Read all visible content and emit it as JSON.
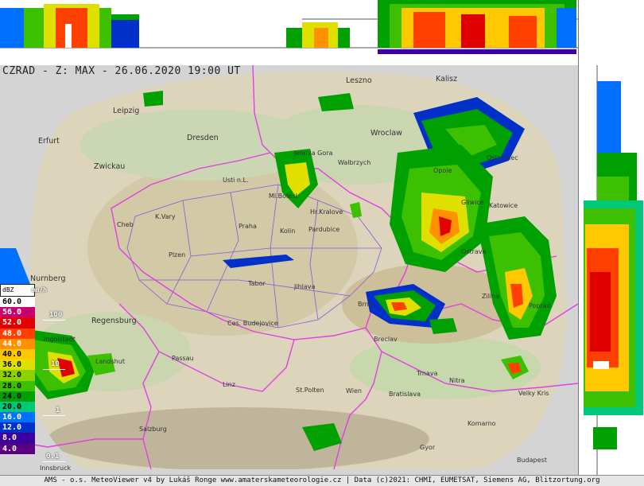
{
  "title": "CZRAD - Z: MAX - 26.06.2020 19:00 UT",
  "footer": "AMS - o.s. MeteoViewer v4 by Lukáš Ronge www.amaterskameteorologie.cz | Data (c)2021: CHMI, EUMETSAT, Siemens AG, Blitzortung.org",
  "legend": {
    "header": "dBZ",
    "unit": "mm/h",
    "rows": [
      {
        "label": "60.0",
        "color": "#ffffff",
        "text": "#000000"
      },
      {
        "label": "56.0",
        "color": "#c8006e",
        "text": "#ffffff"
      },
      {
        "label": "52.0",
        "color": "#e00000",
        "text": "#ffffff"
      },
      {
        "label": "48.0",
        "color": "#ff4000",
        "text": "#ffffff"
      },
      {
        "label": "44.0",
        "color": "#ff9000",
        "text": "#ffffff"
      },
      {
        "label": "40.0",
        "color": "#ffc800",
        "text": "#000000"
      },
      {
        "label": "36.0",
        "color": "#e0e000",
        "text": "#000000"
      },
      {
        "label": "32.0",
        "color": "#8cd200",
        "text": "#000000"
      },
      {
        "label": "28.0",
        "color": "#3cc000",
        "text": "#000000"
      },
      {
        "label": "24.0",
        "color": "#00a000",
        "text": "#000000"
      },
      {
        "label": "20.0",
        "color": "#00c878",
        "text": "#000000"
      },
      {
        "label": "16.0",
        "color": "#0070ff",
        "text": "#ffffff"
      },
      {
        "label": "12.0",
        "color": "#0030c8",
        "text": "#ffffff"
      },
      {
        "label": "8.0",
        "color": "#3c00a0",
        "text": "#ffffff"
      },
      {
        "label": "4.0",
        "color": "#5a0082",
        "text": "#ffffff"
      }
    ],
    "rates": [
      "100",
      "10",
      "1",
      "0.1"
    ]
  },
  "cities": [
    {
      "name": "Leszno"
    },
    {
      "name": "Kalisz"
    },
    {
      "name": "Leipzig"
    },
    {
      "name": "Wroclaw"
    },
    {
      "name": "Erfurt"
    },
    {
      "name": "Dresden"
    },
    {
      "name": "Jelenia Gora"
    },
    {
      "name": "Walbrzych"
    },
    {
      "name": "Ostrowiec"
    },
    {
      "name": "Zwickau"
    },
    {
      "name": "Opole"
    },
    {
      "name": "Usti n.L."
    },
    {
      "name": "Ml.Bolesl."
    },
    {
      "name": "Hr.Kralove"
    },
    {
      "name": "Gliwice"
    },
    {
      "name": "Katowice"
    },
    {
      "name": "K.Vary"
    },
    {
      "name": "Cheb"
    },
    {
      "name": "Praha"
    },
    {
      "name": "Kolin"
    },
    {
      "name": "Pardubice"
    },
    {
      "name": "Ostrava"
    },
    {
      "name": "Plzen"
    },
    {
      "name": "Nurnberg"
    },
    {
      "name": "Tabor"
    },
    {
      "name": "Jihlava"
    },
    {
      "name": "Zilina"
    },
    {
      "name": "Poprad"
    },
    {
      "name": "Brno"
    },
    {
      "name": "Regensburg"
    },
    {
      "name": "Ces. Budejovice"
    },
    {
      "name": "Ingolstadt"
    },
    {
      "name": "Breclav"
    },
    {
      "name": "Landshut"
    },
    {
      "name": "Passau"
    },
    {
      "name": "Trnava"
    },
    {
      "name": "Nitra"
    },
    {
      "name": "Linz"
    },
    {
      "name": "St.Polten"
    },
    {
      "name": "Wien"
    },
    {
      "name": "Bratislava"
    },
    {
      "name": "Velky Kris"
    },
    {
      "name": "Komarno"
    },
    {
      "name": "Salzburg"
    },
    {
      "name": "Gyor"
    },
    {
      "name": "Budapest"
    },
    {
      "name": "Innsbruck"
    }
  ]
}
